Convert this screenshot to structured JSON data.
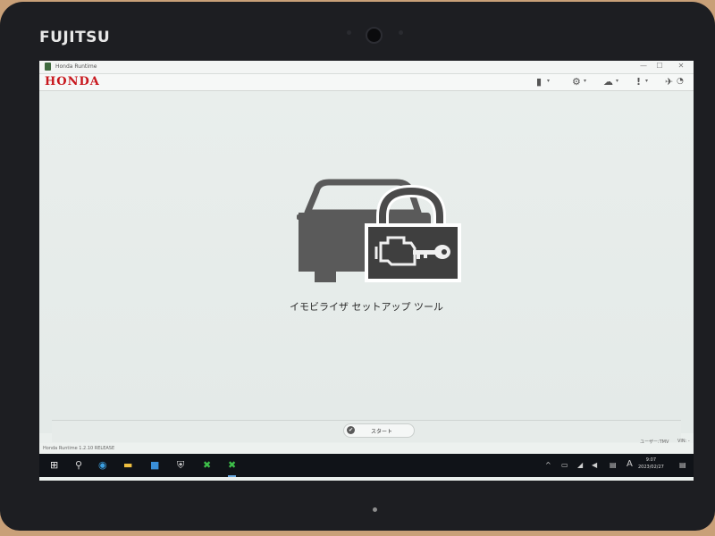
{
  "device": {
    "brand": "FUJITSU"
  },
  "window": {
    "title": "Honda Runtime",
    "controls": {
      "minimize": "—",
      "maximize": "☐",
      "close": "✕"
    }
  },
  "toolbar": {
    "logo": "HONDA",
    "icons": [
      {
        "name": "vehicle-connector-icon",
        "glyph": "▮",
        "caret": "▾"
      },
      {
        "name": "gear-icon",
        "glyph": "⚙",
        "caret": "▾"
      },
      {
        "name": "network-icon",
        "glyph": "☁",
        "caret": "▾"
      },
      {
        "name": "alert-icon",
        "glyph": "!",
        "caret": "▾"
      },
      {
        "name": "status-icon",
        "glyph": "✈",
        "caret": ""
      }
    ]
  },
  "main": {
    "app_name": "イモビライザ セットアップ ツール"
  },
  "footer": {
    "start_label": "スタート",
    "start_check": "✔"
  },
  "status_bar": {
    "version": "Honda Runtime 1.2.10 RELEASE",
    "user": "ユーザー:TMV",
    "vin": "VIN: -"
  },
  "taskbar": {
    "start": "⊞",
    "search": "⚲",
    "apps": [
      "◉",
      "▬",
      "■",
      "⛨",
      "✖",
      "✖"
    ],
    "tray": [
      "^",
      "▭",
      "◢",
      "◀",
      "▤",
      "A"
    ],
    "time": "9:07",
    "date": "2023/02/27",
    "notification": "▤"
  },
  "colors": {
    "honda_red": "#c8171d",
    "icon_gray": "#5a5a5a",
    "taskbar": "#101318"
  }
}
